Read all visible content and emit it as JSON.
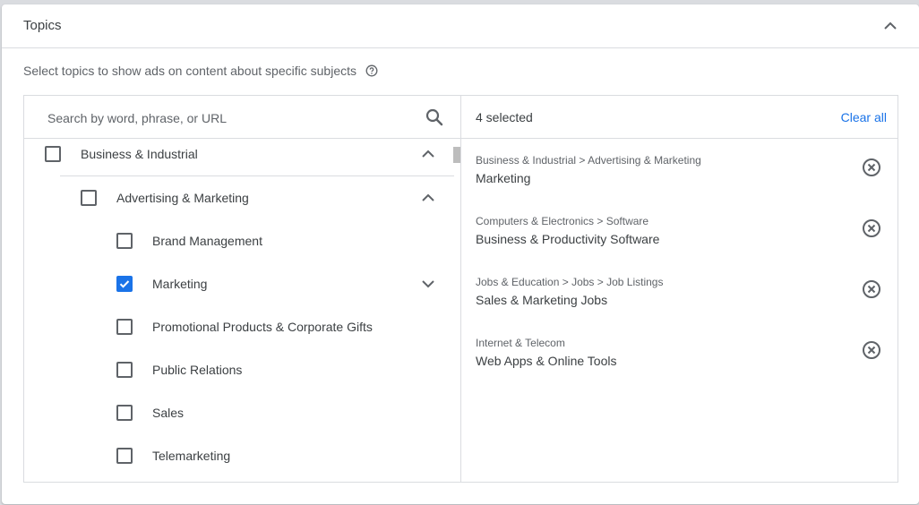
{
  "card": {
    "title": "Topics",
    "description": "Select topics to show ads on content about specific subjects"
  },
  "search": {
    "placeholder": "Search by word, phrase, or URL",
    "value": ""
  },
  "tree": {
    "items": [
      {
        "label": "Business & Industrial",
        "level": 0,
        "checked": false,
        "expander": "collapse"
      },
      {
        "label": "Advertising & Marketing",
        "level": 1,
        "checked": false,
        "expander": "collapse"
      },
      {
        "label": "Brand Management",
        "level": 2,
        "checked": false,
        "expander": null
      },
      {
        "label": "Marketing",
        "level": 2,
        "checked": true,
        "expander": "expand"
      },
      {
        "label": "Promotional Products & Corporate Gifts",
        "level": 2,
        "checked": false,
        "expander": null
      },
      {
        "label": "Public Relations",
        "level": 2,
        "checked": false,
        "expander": null
      },
      {
        "label": "Sales",
        "level": 2,
        "checked": false,
        "expander": null
      },
      {
        "label": "Telemarketing",
        "level": 2,
        "checked": false,
        "expander": null
      }
    ]
  },
  "selected": {
    "count_label": "4 selected",
    "clear_all_label": "Clear all",
    "items": [
      {
        "path": "Business & Industrial > Advertising & Marketing",
        "name": "Marketing"
      },
      {
        "path": "Computers & Electronics > Software",
        "name": "Business & Productivity Software"
      },
      {
        "path": "Jobs & Education > Jobs > Job Listings",
        "name": "Sales & Marketing Jobs"
      },
      {
        "path": "Internet & Telecom",
        "name": "Web Apps & Online Tools"
      }
    ]
  },
  "colors": {
    "accent": "#1a73e8",
    "text": "#3c4043",
    "secondary_text": "#5f6368",
    "divider": "#dadce0"
  }
}
